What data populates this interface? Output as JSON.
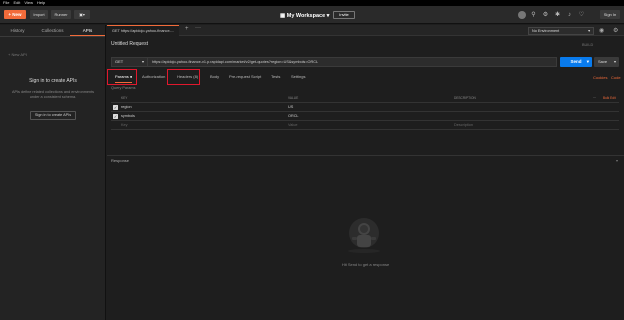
{
  "menu": [
    "File",
    "Edit",
    "View",
    "Help"
  ],
  "toolbar": {
    "new_label": "+ New",
    "import_label": "Import",
    "runner_label": "Runner",
    "workspace_label": "My Workspace ▾",
    "invite_label": "Invite",
    "signin_label": "Sign In"
  },
  "sidebar": {
    "tabs": [
      "History",
      "Collections",
      "APIs"
    ],
    "new_api": "+ New API",
    "title": "Sign in to create APIs",
    "description": "APIs define related collections and environments under a consistent schema.",
    "button": "Sign in to create APIs"
  },
  "tabs": {
    "request_tab": "GET https://apidojo-yahoo-finance-...",
    "plus": "+",
    "more": "···"
  },
  "env": {
    "selected": "No Environment"
  },
  "request": {
    "name": "Untitled Request",
    "build": "BUILD",
    "method": "GET",
    "url": "https://apidojo-yahoo-finance-v1.p.rapidapi.com/market/v2/get-quotes?region=US&symbols=ORCL",
    "send": "Send",
    "save": "Save"
  },
  "param_tabs": {
    "params": "Params ●",
    "authorization": "Authorization",
    "headers": "Headers (8)",
    "body": "Body",
    "prerequest": "Pre-request Script",
    "tests": "Tests",
    "settings": "Settings",
    "cookies": "Cookies",
    "code": "Code"
  },
  "query_params": {
    "title": "Query Params",
    "headers": {
      "key": "KEY",
      "value": "VALUE",
      "description": "DESCRIPTION"
    },
    "rows": [
      {
        "key": "region",
        "value": "US",
        "description": ""
      },
      {
        "key": "symbols",
        "value": "ORCL",
        "description": ""
      }
    ],
    "placeholder": {
      "key": "Key",
      "value": "Value",
      "description": "Description"
    },
    "dots": "···",
    "bulk_edit": "Bulk Edit"
  },
  "response": {
    "label": "Response",
    "hint": "Hit Send to get a response"
  },
  "colors": {
    "accent": "#f26b3a",
    "send": "#097bed",
    "highlight": "#e0182d"
  }
}
